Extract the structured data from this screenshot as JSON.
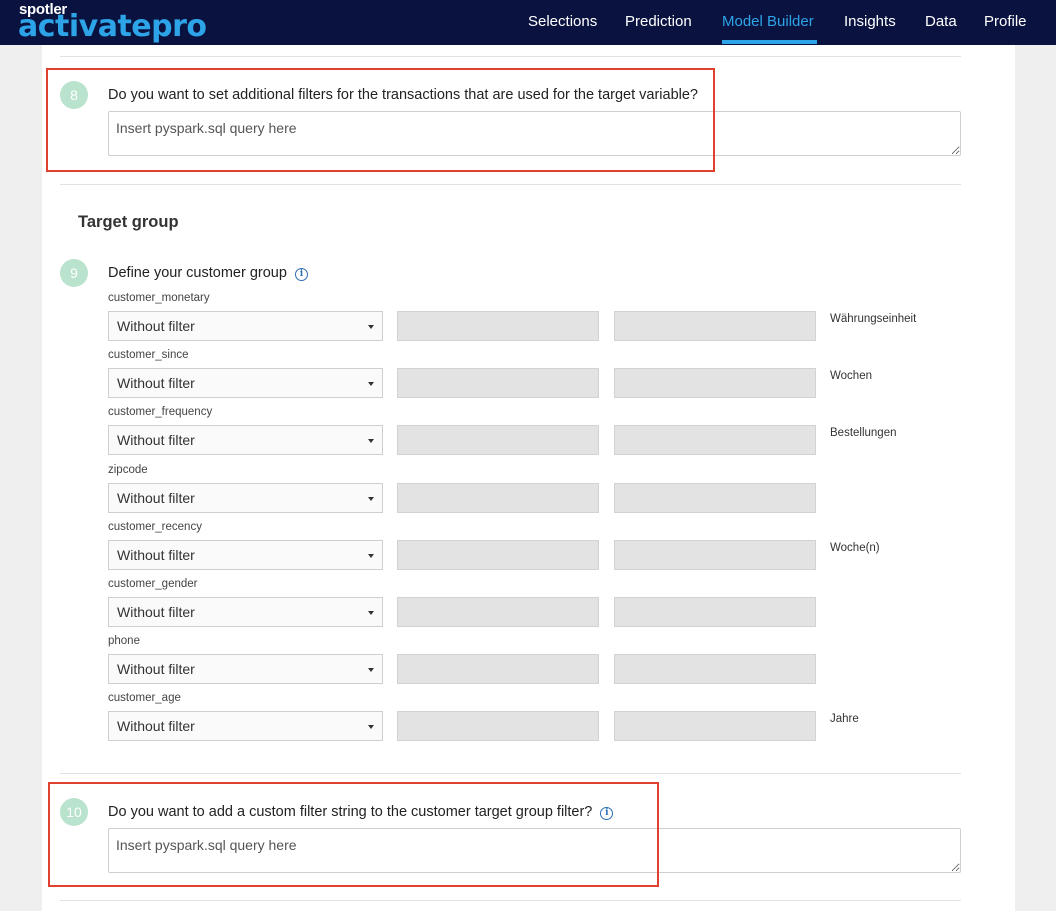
{
  "header": {
    "logo_top": "spotler",
    "logo_main": "activatepro",
    "nav": [
      "Selections",
      "Prediction",
      "Model Builder",
      "Insights",
      "Data",
      "Profile"
    ],
    "active_nav": "Model Builder"
  },
  "step8": {
    "number": "8",
    "question": "Do you want to set additional filters for the transactions that are used for the target variable?",
    "placeholder": "Insert pyspark.sql query here"
  },
  "target_group": {
    "title": "Target group",
    "step9": {
      "number": "9",
      "question": "Define your customer group"
    },
    "fields": [
      {
        "label": "customer_monetary",
        "select": "Without filter",
        "unit": "Währungseinheit"
      },
      {
        "label": "customer_since",
        "select": "Without filter",
        "unit": "Wochen"
      },
      {
        "label": "customer_frequency",
        "select": "Without filter",
        "unit": "Bestellungen"
      },
      {
        "label": "zipcode",
        "select": "Without filter",
        "unit": ""
      },
      {
        "label": "customer_recency",
        "select": "Without filter",
        "unit": "Woche(n)"
      },
      {
        "label": "customer_gender",
        "select": "Without filter",
        "unit": ""
      },
      {
        "label": "phone",
        "select": "Without filter",
        "unit": ""
      },
      {
        "label": "customer_age",
        "select": "Without filter",
        "unit": "Jahre"
      }
    ]
  },
  "step10": {
    "number": "10",
    "question": "Do you want to add a custom filter string to the customer target group filter?",
    "placeholder": "Insert pyspark.sql query here"
  },
  "colors": {
    "header_bg": "#0a1340",
    "accent": "#2da4e8",
    "step_badge": "#b9e3cd",
    "highlight": "#e0402e"
  }
}
